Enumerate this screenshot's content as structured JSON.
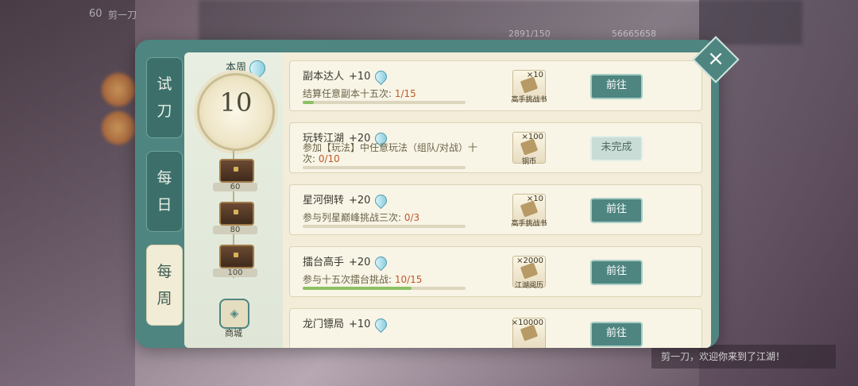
{
  "hud": {
    "level": "60",
    "player_name": "剪一刀",
    "currency1": "2891/150",
    "currency2": "56665658",
    "chat": "剪一刀，欢迎你来到了江湖！"
  },
  "tabs": [
    {
      "label_a": "试",
      "label_b": "刀",
      "active": false
    },
    {
      "label_a": "每",
      "label_b": "日",
      "active": false
    },
    {
      "label_a": "每",
      "label_b": "周",
      "active": true
    }
  ],
  "weekly": {
    "label": "本周",
    "value": "10",
    "milestones": [
      {
        "label": "60"
      },
      {
        "label": "80"
      },
      {
        "label": "100"
      }
    ],
    "shop_label": "商城",
    "shop_icon": "shop-icon"
  },
  "tasks": [
    {
      "title": "副本达人",
      "points": "+10",
      "desc": "结算任意副本十五次: ",
      "progress": "1/15",
      "progress_ratio": 0.0667,
      "reward_qty": "×10",
      "reward_name": "高手挑战书",
      "button": "前往",
      "button_state": "enabled"
    },
    {
      "title": "玩转江湖",
      "points": "+20",
      "desc": "参加【玩法】中任意玩法（组队/对战）十次: ",
      "progress": "0/10",
      "progress_ratio": 0.0,
      "reward_qty": "×100",
      "reward_name": "铜币",
      "button": "未完成",
      "button_state": "disabled"
    },
    {
      "title": "星河倒转",
      "points": "+20",
      "desc": "参与列星巅峰挑战三次: ",
      "progress": "0/3",
      "progress_ratio": 0.0,
      "reward_qty": "×10",
      "reward_name": "高手挑战书",
      "button": "前往",
      "button_state": "enabled"
    },
    {
      "title": "擂台高手",
      "points": "+20",
      "desc": "参与十五次擂台挑战: ",
      "progress": "10/15",
      "progress_ratio": 0.6667,
      "reward_qty": "×2000",
      "reward_name": "江湖阅历",
      "button": "前往",
      "button_state": "enabled"
    },
    {
      "title": "龙门镖局",
      "points": "+10",
      "desc": "",
      "progress": "",
      "progress_ratio": 0.0,
      "reward_qty": "×10000",
      "reward_name": "",
      "button": "前往",
      "button_state": "enabled"
    }
  ],
  "close_label": "×",
  "colors": {
    "panel": "#4f8580",
    "card": "#f8f4e6",
    "progress_fill": "#8cc063",
    "progress_text": "#c0592a"
  }
}
